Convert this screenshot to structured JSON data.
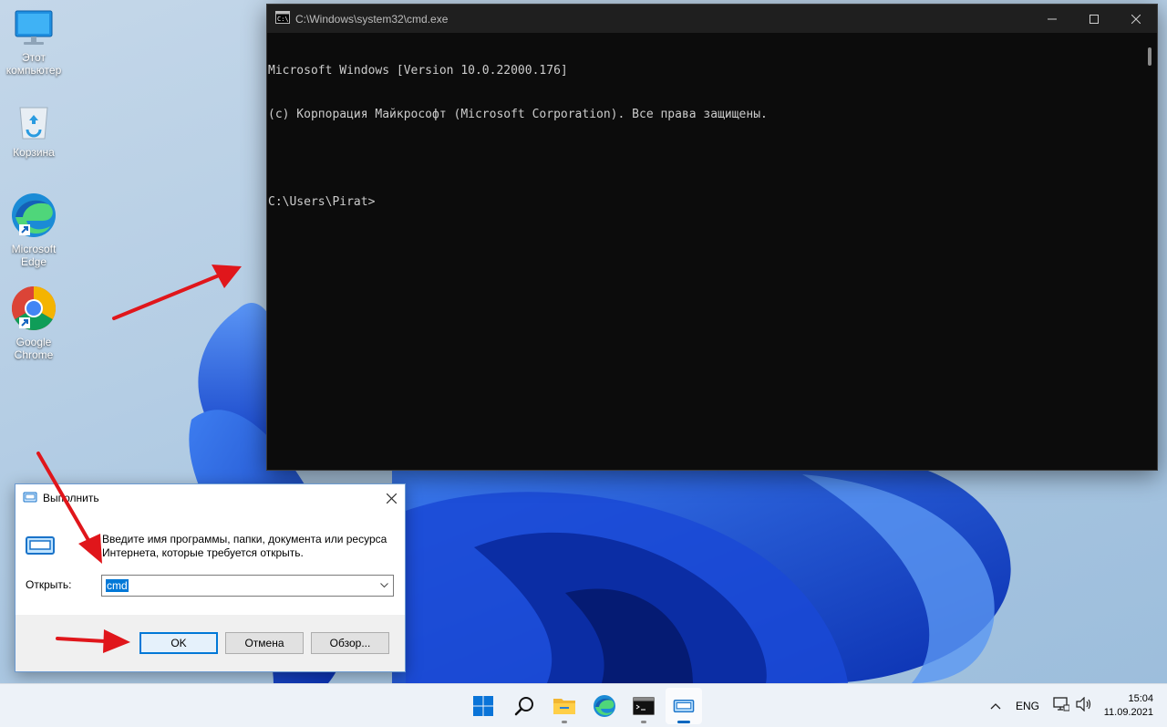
{
  "desktop": {
    "icons": [
      {
        "label": "Этот\nкомпьютер",
        "icon": "this-pc-icon"
      },
      {
        "label": "Корзина",
        "icon": "recycle-bin-icon"
      },
      {
        "label": "Microsoft\nEdge",
        "icon": "edge-icon"
      },
      {
        "label": "Google\nChrome",
        "icon": "chrome-icon"
      }
    ]
  },
  "cmd": {
    "title": "C:\\Windows\\system32\\cmd.exe",
    "lines": [
      "Microsoft Windows [Version 10.0.22000.176]",
      "(c) Корпорация Майкрософт (Microsoft Corporation). Все права защищены.",
      "",
      "C:\\Users\\Pirat>"
    ]
  },
  "run": {
    "title": "Выполнить",
    "description": "Введите имя программы, папки, документа или ресурса Интернета, которые требуется открыть.",
    "open_label": "Открыть:",
    "input_value": "cmd",
    "ok": "OK",
    "cancel": "Отмена",
    "browse": "Обзор..."
  },
  "taskbar": {
    "items": [
      "start-icon",
      "search-icon",
      "file-explorer-icon",
      "edge-icon",
      "cmd-icon",
      "run-icon"
    ],
    "active": "run-icon",
    "lang": "ENG",
    "time": "15:04",
    "date": "11.09.2021"
  },
  "colors": {
    "accent": "#0078d7",
    "annotation_arrow": "#e0161b",
    "console_bg": "#0c0c0c",
    "console_text": "#cccccc"
  }
}
